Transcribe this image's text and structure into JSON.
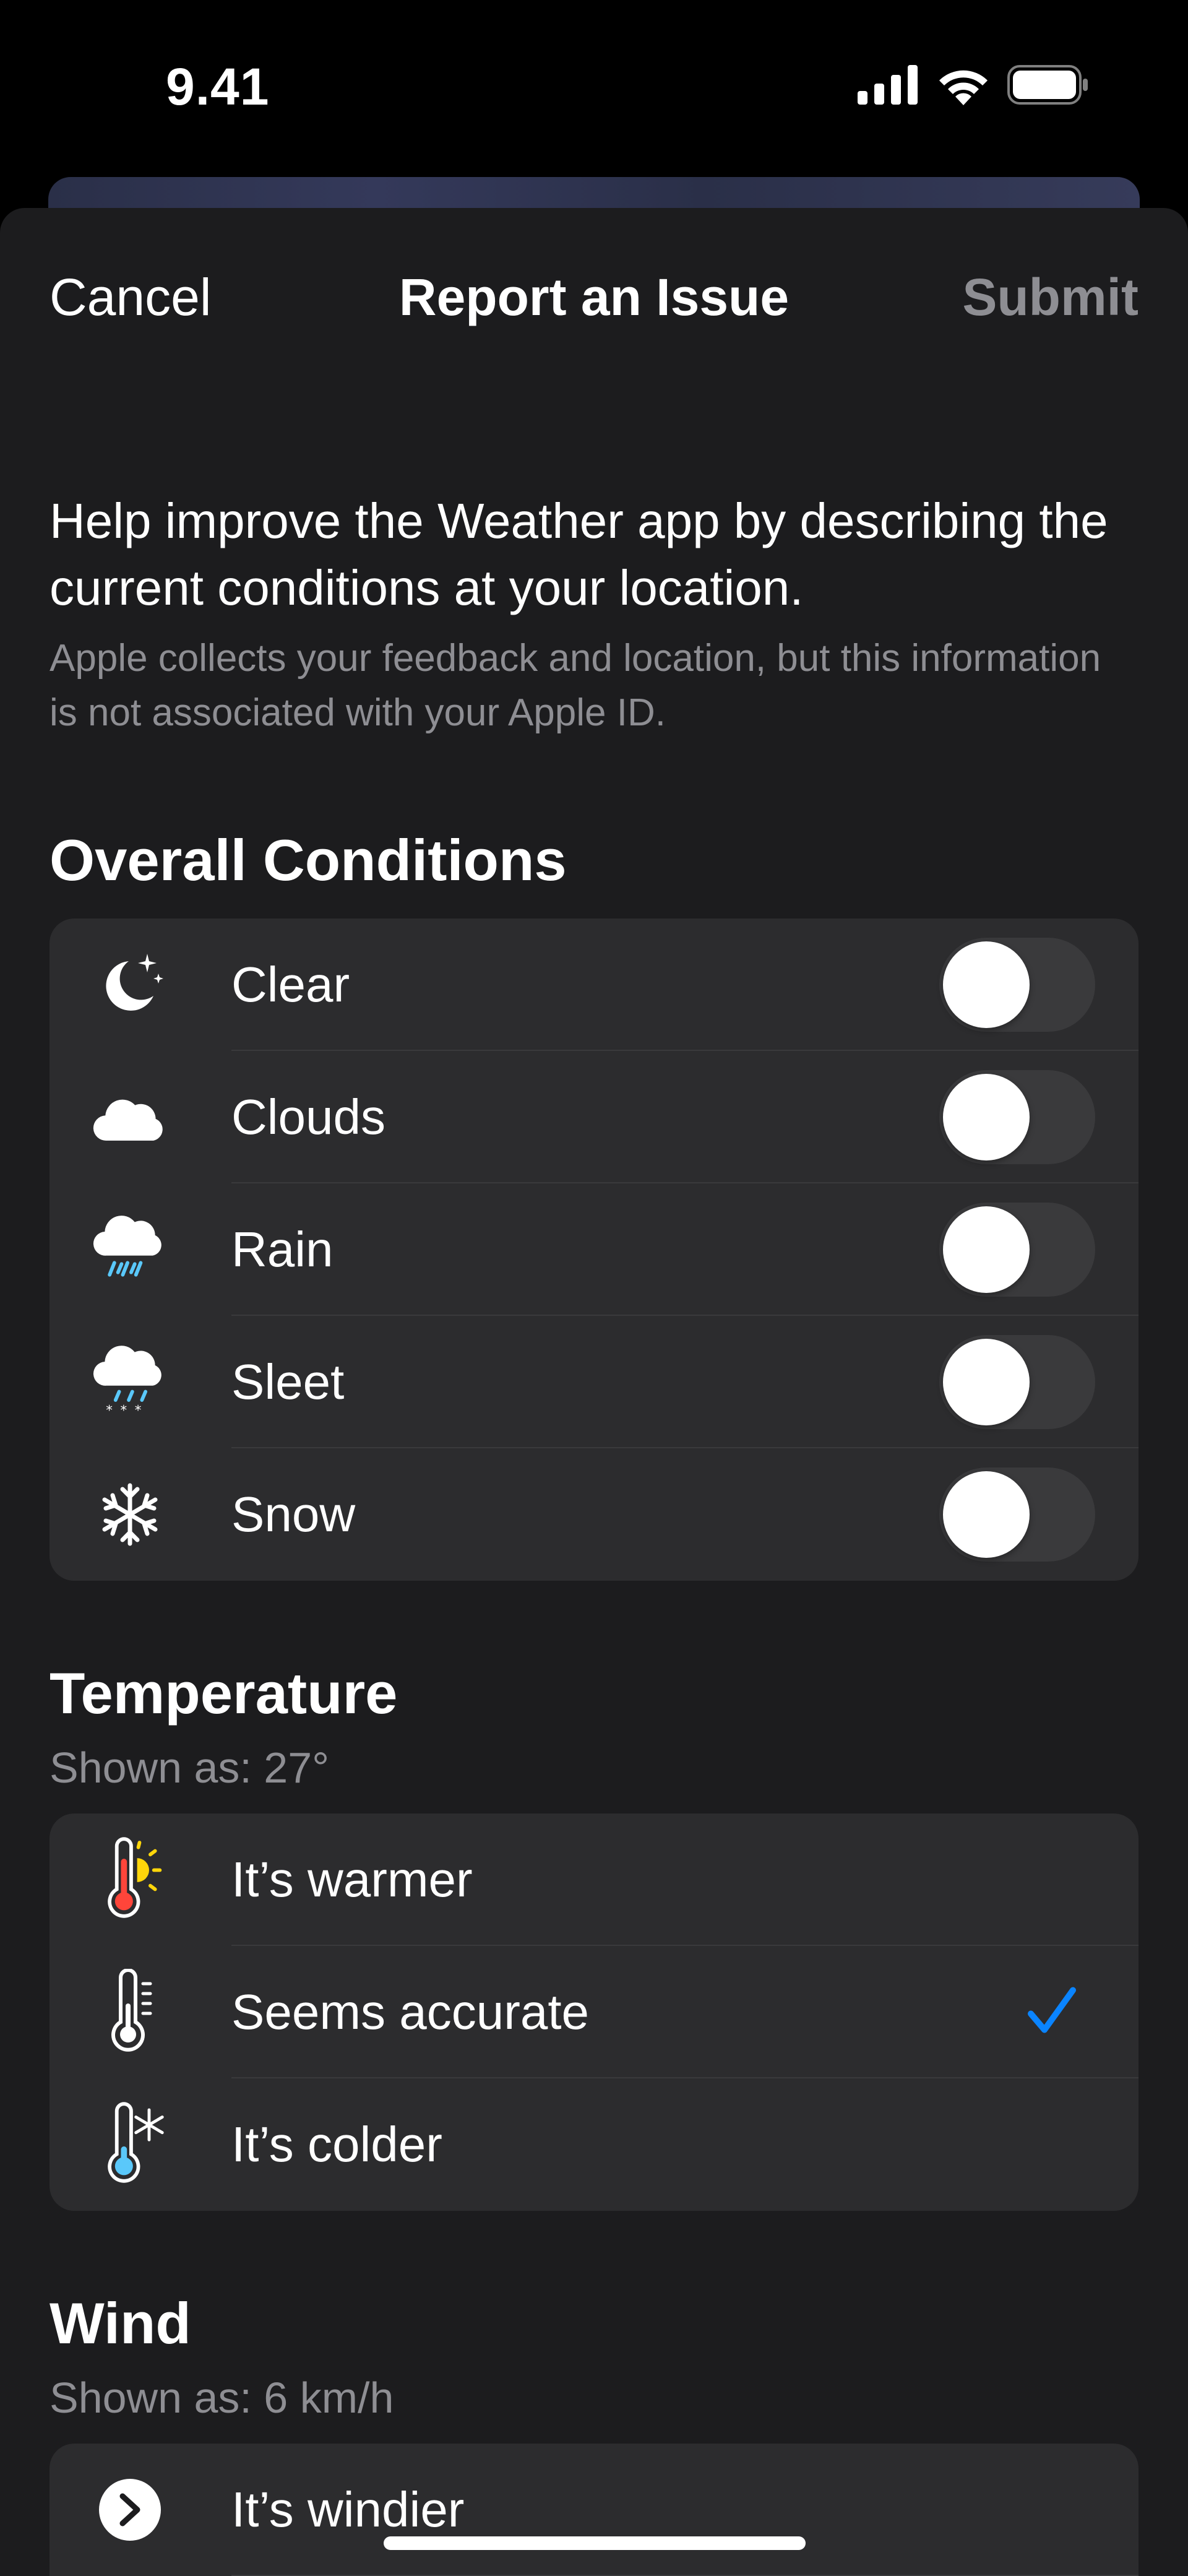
{
  "status_bar": {
    "time": "9.41"
  },
  "nav": {
    "cancel": "Cancel",
    "title": "Report an Issue",
    "submit": "Submit"
  },
  "intro": {
    "main": "Help improve the Weather app by describing the current conditions at your location.",
    "sub": "Apple collects your feedback and location, but this information is not associated with your Apple ID."
  },
  "overall": {
    "title": "Overall Conditions",
    "items": [
      {
        "label": "Clear",
        "icon": "moon-stars-icon",
        "on": false
      },
      {
        "label": "Clouds",
        "icon": "cloud-icon",
        "on": false
      },
      {
        "label": "Rain",
        "icon": "cloud-rain-icon",
        "on": false
      },
      {
        "label": "Sleet",
        "icon": "cloud-sleet-icon",
        "on": false
      },
      {
        "label": "Snow",
        "icon": "snowflake-icon",
        "on": false
      }
    ]
  },
  "temperature": {
    "title": "Temperature",
    "shown": "Shown as: 27°",
    "items": [
      {
        "label": "It’s warmer",
        "icon": "thermometer-sun-icon",
        "selected": false
      },
      {
        "label": "Seems accurate",
        "icon": "thermometer-icon",
        "selected": true
      },
      {
        "label": "It’s colder",
        "icon": "thermometer-snowflake-icon",
        "selected": false
      }
    ]
  },
  "wind": {
    "title": "Wind",
    "shown": "Shown as: 6 km/h",
    "items": [
      {
        "label": "It’s windier",
        "icon": "arrow-circle-icon"
      }
    ]
  },
  "colors": {
    "accent": "#0a84ff",
    "background": "#1c1c1e",
    "cell": "#2c2c2e",
    "secondary_text": "#8e8e93"
  }
}
